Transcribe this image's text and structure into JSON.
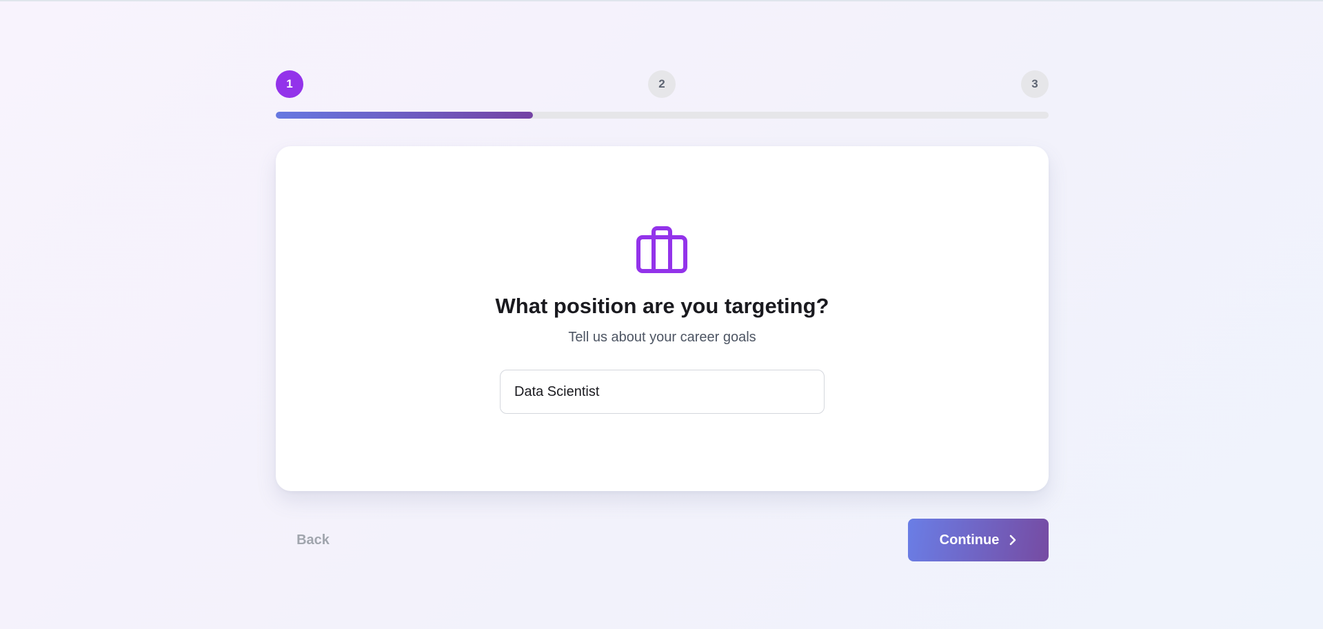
{
  "stepper": {
    "steps": [
      {
        "label": "1",
        "active": true
      },
      {
        "label": "2",
        "active": false
      },
      {
        "label": "3",
        "active": false
      }
    ],
    "progress_fraction": 0.333,
    "progress_color_start": "#6678e1",
    "progress_color_end": "#7443a4"
  },
  "card": {
    "icon": "briefcase-icon",
    "icon_color": "#9333ea",
    "title": "What position are you targeting?",
    "subtitle": "Tell us about your career goals",
    "position_input": {
      "value": "Data Scientist",
      "placeholder": ""
    }
  },
  "actions": {
    "back_label": "Back",
    "continue_label": "Continue",
    "continue_icon": "chevron-right-icon"
  }
}
